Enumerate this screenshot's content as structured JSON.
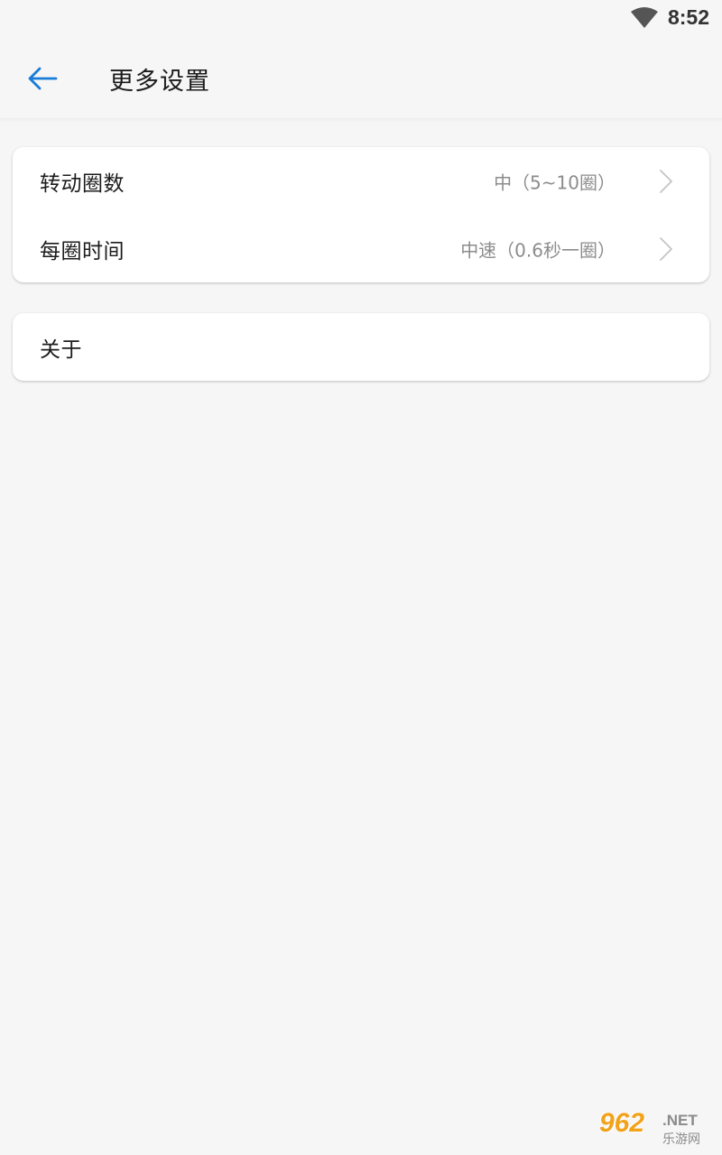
{
  "status_bar": {
    "time": "8:52",
    "wifi_icon": "wifi-icon"
  },
  "header": {
    "back_icon": "arrow-left-icon",
    "title": "更多设置",
    "accent_color": "#1a7bd8"
  },
  "settings": [
    {
      "label": "转动圈数",
      "value": "中（5~10圈）",
      "chevron_icon": "chevron-right-icon"
    },
    {
      "label": "每圈时间",
      "value": "中速（0.6秒一圈）",
      "chevron_icon": "chevron-right-icon"
    }
  ],
  "about": {
    "label": "关于"
  },
  "watermark": {
    "brand": "962",
    "suffix": ".NET",
    "subtitle": "乐游网"
  },
  "colors": {
    "background": "#f6f6f6",
    "card": "#ffffff",
    "primary_text": "#1c1c1c",
    "secondary_text": "#8c8c8c"
  }
}
